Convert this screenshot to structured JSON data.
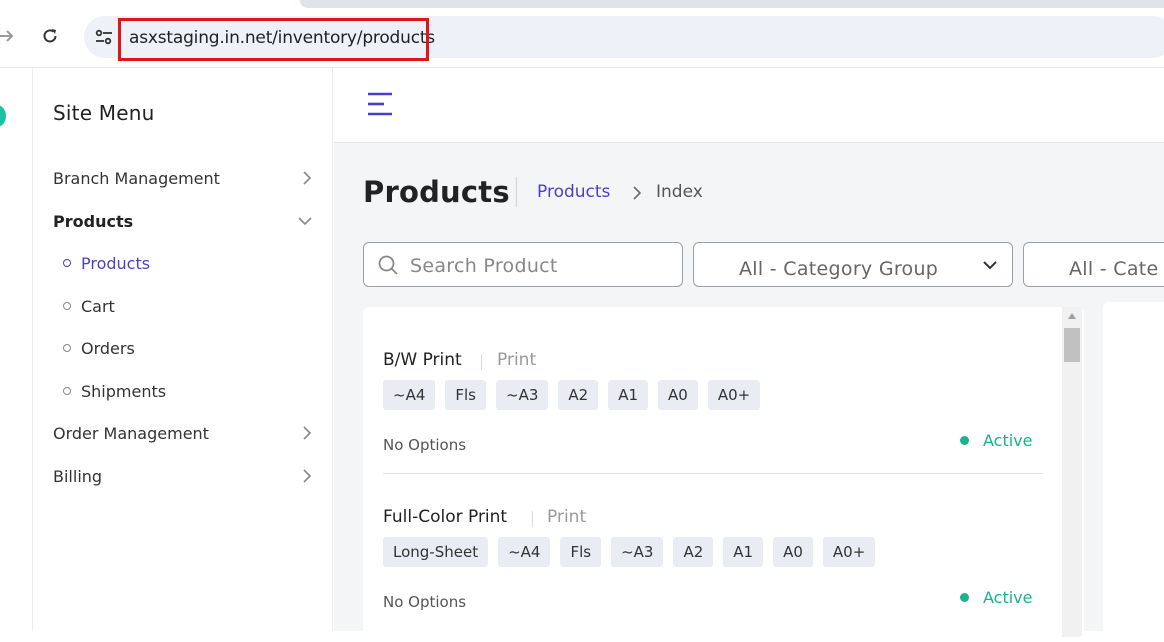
{
  "browser": {
    "url": "asxstaging.in.net/inventory/products"
  },
  "sidebar": {
    "title": "Site Menu",
    "items": [
      {
        "label": "Branch Management"
      },
      {
        "label": "Products"
      },
      {
        "label": "Order Management"
      },
      {
        "label": "Billing"
      }
    ],
    "subitems": [
      {
        "label": "Products",
        "active": true
      },
      {
        "label": "Cart"
      },
      {
        "label": "Orders"
      },
      {
        "label": "Shipments"
      }
    ]
  },
  "main": {
    "title": "Products",
    "breadcrumb": {
      "link": "Products",
      "current": "Index"
    },
    "search_placeholder": "Search Product",
    "filter_category_group": "All - Category Group",
    "filter_category": "All - Cate"
  },
  "products": [
    {
      "name": "B/W Print",
      "category": "Print",
      "tags": [
        "~A4",
        "Fls",
        "~A3",
        "A2",
        "A1",
        "A0",
        "A0+"
      ],
      "options": "No Options",
      "status": "Active"
    },
    {
      "name": "Full-Color Print",
      "category": "Print",
      "tags": [
        "Long-Sheet",
        "~A4",
        "Fls",
        "~A3",
        "A2",
        "A1",
        "A0",
        "A0+"
      ],
      "options": "No Options",
      "status": "Active"
    }
  ],
  "colors": {
    "accent": "#4b3fc9",
    "active_status": "#1bb28a",
    "highlight_box": "#e0141c"
  }
}
